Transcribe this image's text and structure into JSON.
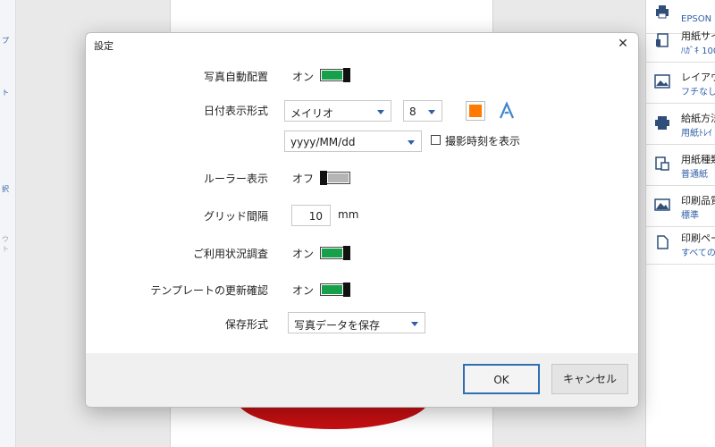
{
  "background": {
    "left_labels": [
      "プ",
      "ト",
      "択",
      "ウト"
    ],
    "right_panel": [
      {
        "title": "",
        "value": "EPSON",
        "icon": "printer-icon"
      },
      {
        "title": "用紙サイ",
        "value": "ﾊｶﾞｷ 100",
        "icon": "paper-size-icon"
      },
      {
        "title": "レイアウ",
        "value": "フチなし",
        "icon": "layout-icon"
      },
      {
        "title": "給紙方法",
        "value": "用紙ﾄﾚｲ",
        "icon": "paper-feed-icon"
      },
      {
        "title": "用紙種類",
        "value": "普通紙",
        "icon": "paper-type-icon"
      },
      {
        "title": "印刷品質",
        "value": "標準",
        "icon": "print-quality-icon"
      },
      {
        "title": "印刷ペー",
        "value": "すべての",
        "icon": "print-pages-icon"
      }
    ],
    "colors": {
      "red_shape": "#c50f12",
      "link_blue": "#2f5fa8"
    }
  },
  "dialog": {
    "title": "設定",
    "close_icon": "close-icon",
    "rows": {
      "auto_placement": {
        "label": "写真自動配置",
        "state": "オン",
        "on": true
      },
      "date_format": {
        "label": "日付表示形式",
        "font": "メイリオ",
        "size": "8",
        "color": "#ff7a00",
        "format": "yyyy/MM/dd",
        "show_time_label": "撮影時刻を表示",
        "show_time_checked": false
      },
      "ruler": {
        "label": "ルーラー表示",
        "state": "オフ",
        "on": false
      },
      "grid": {
        "label": "グリッド間隔",
        "value": "10",
        "unit": "mm"
      },
      "usage_survey": {
        "label": "ご利用状況調査",
        "state": "オン",
        "on": true
      },
      "template_update": {
        "label": "テンプレートの更新確認",
        "state": "オン",
        "on": true
      },
      "save_format": {
        "label": "保存形式",
        "value": "写真データを保存"
      }
    },
    "buttons": {
      "ok": "OK",
      "cancel": "キャンセル"
    },
    "colors": {
      "toggle_on": "#17a04a",
      "toggle_off": "#b5b5b5",
      "accent": "#2f6fb2"
    }
  }
}
